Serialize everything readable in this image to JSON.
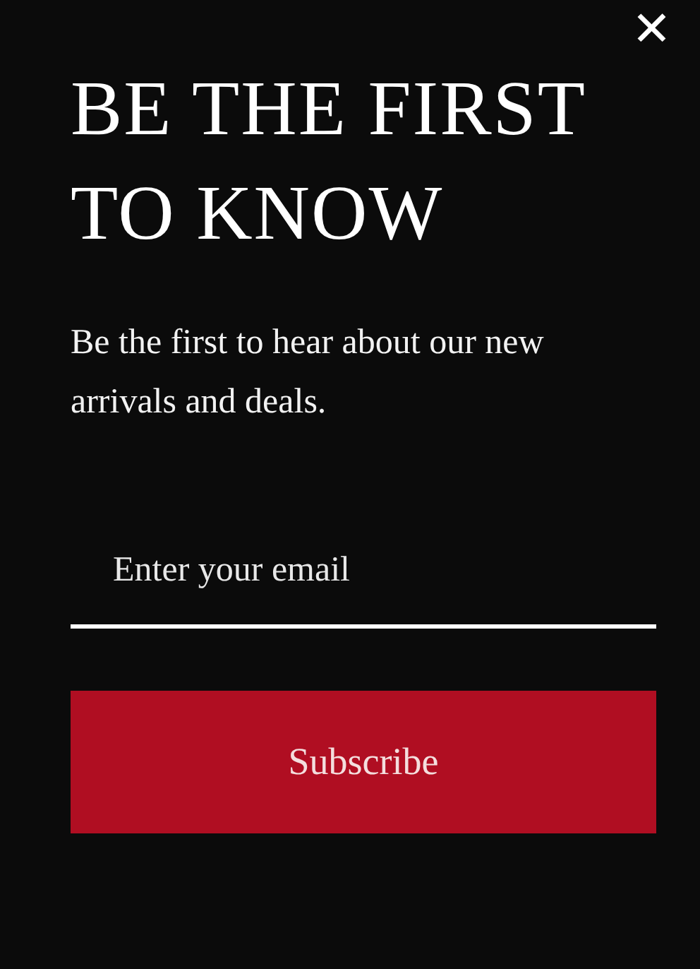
{
  "close": {
    "label": "✕"
  },
  "title": "BE THE FIRST TO KNOW",
  "description": "Be the first to hear about our new arrivals and deals.",
  "email_field": {
    "placeholder": "Enter your email"
  },
  "subscribe_button": {
    "label": "Subscribe"
  }
}
